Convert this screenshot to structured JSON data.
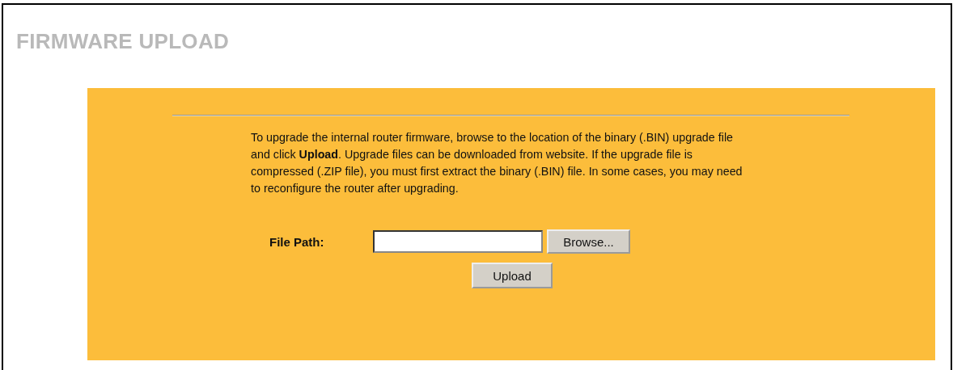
{
  "page": {
    "title": "FIRMWARE UPLOAD"
  },
  "instructions": "To upgrade the internal router firmware, browse to the location of the binary (.BIN) upgrade file and click **Upload**. Upgrade files can be downloaded from website. If the upgrade file is compressed (.ZIP file), you must first extract the binary (.BIN) file. In some cases, you may need to reconfigure the router after upgrading.",
  "file_path": {
    "label": "File Path:",
    "browse_button": "Browse..."
  },
  "upload_button": "Upload"
}
